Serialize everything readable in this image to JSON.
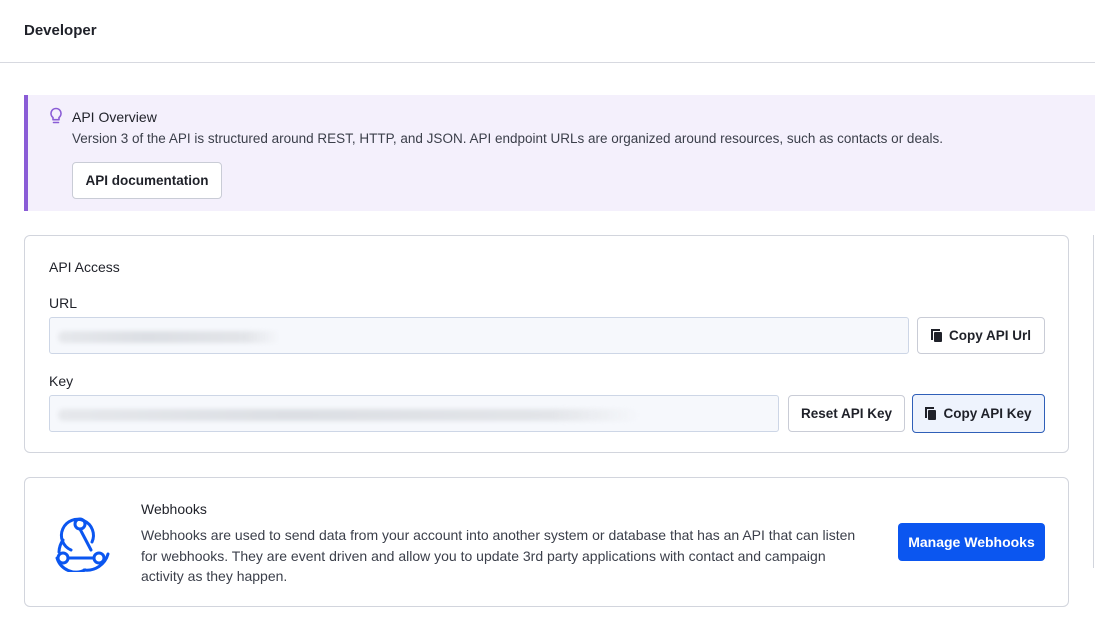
{
  "header": {
    "title": "Developer"
  },
  "callout": {
    "icon": "lightbulb-icon",
    "title": "API Overview",
    "body": "Version 3 of the API is structured around REST, HTTP, and JSON. API endpoint URLs are organized around resources, such as contacts or deals.",
    "button_label": "API documentation",
    "accent_color": "#8a5cd6",
    "background_color": "#f4f0fc"
  },
  "api_access": {
    "title": "API Access",
    "url_label": "URL",
    "url_value": "",
    "copy_url_label": "Copy API Url",
    "key_label": "Key",
    "key_value": "",
    "reset_key_label": "Reset API Key",
    "copy_key_label": "Copy API Key",
    "copy_icon": "copy-icon"
  },
  "webhooks": {
    "icon": "webhook-icon",
    "title": "Webhooks",
    "body": "Webhooks are used to send data from your account into another system or database that has an API that can listen for webhooks. They are event driven and allow you to update 3rd party applications with contact and campaign activity as they happen.",
    "button_label": "Manage Webhooks",
    "button_color": "#0b56f0",
    "icon_color": "#0b56f0"
  }
}
